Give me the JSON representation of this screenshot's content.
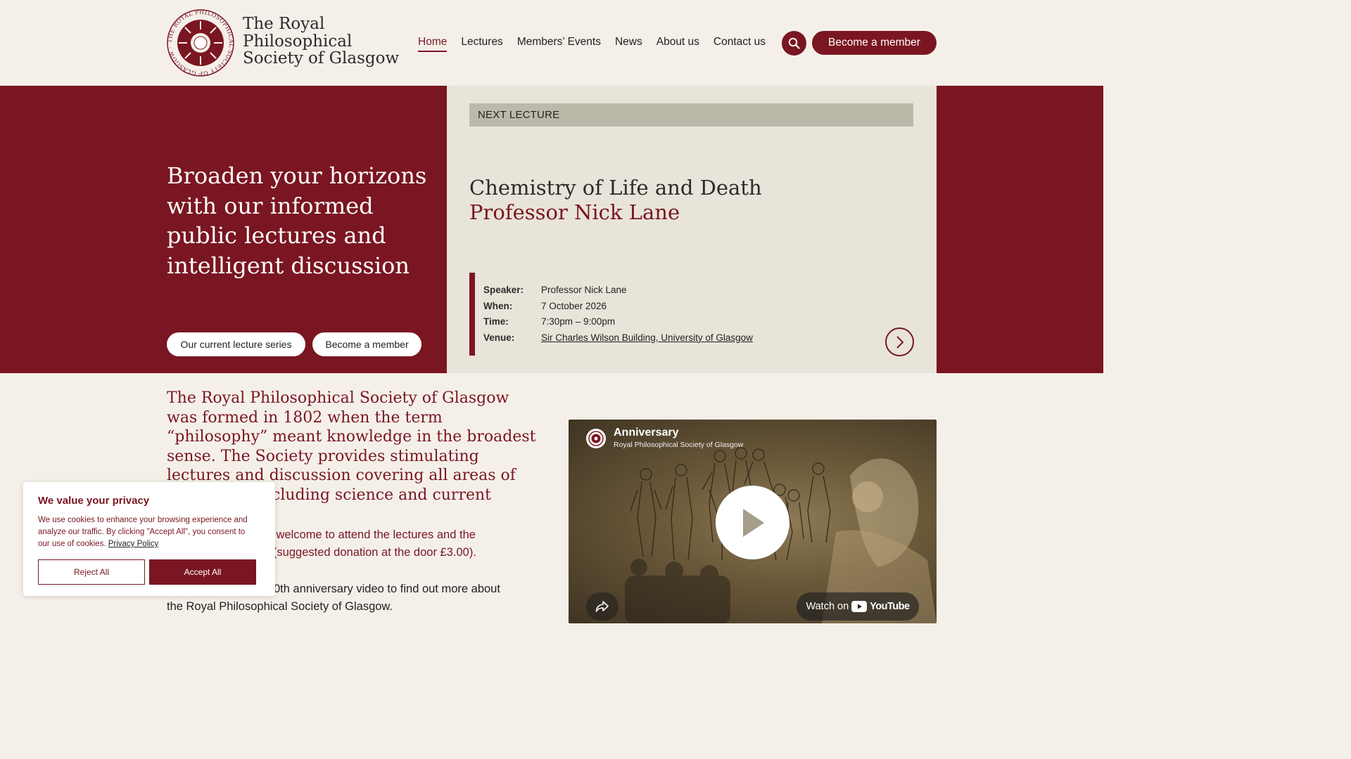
{
  "colors": {
    "brand": "#7a1621",
    "background": "#f4f0e9",
    "panel": "#e8e4d9"
  },
  "header": {
    "logo_text": "THE ROYAL PHILOSOPHICAL SOCIETY OF GLASGOW · 9TH NOV 1802",
    "brand_line1": "The Royal",
    "brand_line2": "Philosophical",
    "brand_line3": "Society of Glasgow",
    "nav": [
      "Home",
      "Lectures",
      "Members’ Events",
      "News",
      "About us",
      "Contact us"
    ],
    "search_icon": "search-icon",
    "member_button": "Become a member"
  },
  "hero": {
    "headline": "Broaden your horizons with our informed public lectures and intelligent discussion",
    "button_series": "Our current lecture series",
    "button_member": "Become a member",
    "next_label": "NEXT LECTURE",
    "lecture_title": "Chemistry of Life and Death",
    "lecture_speaker": "Professor Nick Lane",
    "details": [
      {
        "key": "Speaker:",
        "value": "Professor Nick Lane"
      },
      {
        "key": "When:",
        "value": "7 October 2026"
      },
      {
        "key": "Time:",
        "value": "7:30pm – 9:00pm"
      },
      {
        "key": "Venue:",
        "value": "Sir Charles Wilson Building, University of Glasgow"
      }
    ],
    "arrow_icon": "chevron-right-icon"
  },
  "main": {
    "intro": "The Royal Philosophical Society of Glasgow was formed in 1802 when the term “philosophy” meant knowledge in the broadest sense. The Society provides stimulating lectures and discussion covering all areas of knowledge including science and current affairs.",
    "visible_para2": "ery welcome to attend the lectures and the\non (suggested donation at the door £3.00).",
    "visible_para3": "0th anniversary video to find out more about\nthe Royal Philosophical Society of Glasgow."
  },
  "video": {
    "title": "Anniversary",
    "channel": "Royal Philosophical Society of Glasgow",
    "watch_on": "Watch on",
    "youtube": "YouTube"
  },
  "cookie": {
    "title": "We value your privacy",
    "text": "We use cookies to enhance your browsing experience and analyze our traffic. By clicking \"Accept All\", you consent to our use of cookies.",
    "privacy_link": "Privacy Policy",
    "reject": "Reject All",
    "accept": "Accept All"
  }
}
